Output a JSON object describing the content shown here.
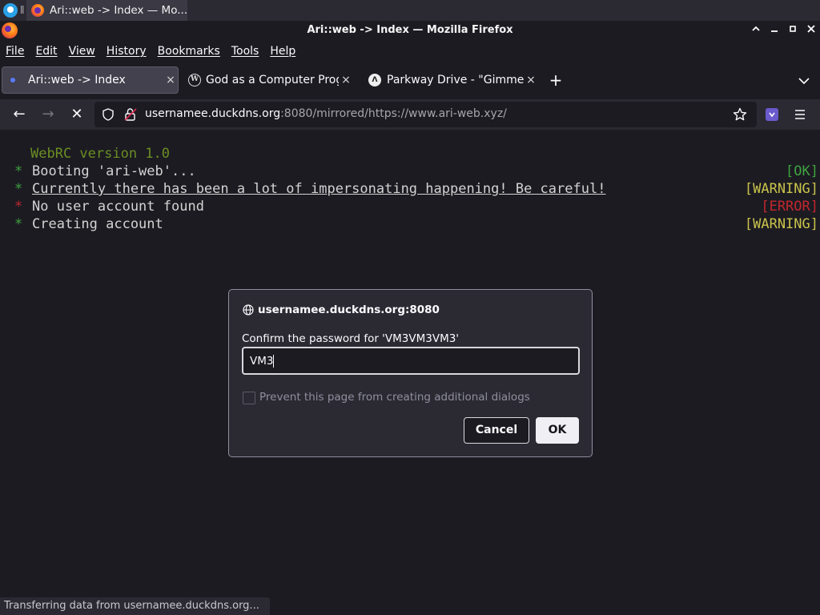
{
  "taskbar": {
    "separator": "ǁ",
    "task_title": "Ari::web -> Index — Mo..."
  },
  "window": {
    "title": "Ari::web -> Index — Mozilla Firefox",
    "controls": {
      "minimize": "–",
      "maximize": "□",
      "close": "✕"
    }
  },
  "menu": [
    "File",
    "Edit",
    "View",
    "History",
    "Bookmarks",
    "Tools",
    "Help"
  ],
  "tabs": [
    {
      "label": "Ari::web -> Index",
      "active": true,
      "close": "×"
    },
    {
      "label": "God as a Computer Progr",
      "favicon": "W",
      "close": "×"
    },
    {
      "label": "Parkway Drive - \"Gimme",
      "favicon": "Λ",
      "close": "×"
    }
  ],
  "newtab": "+",
  "nav": {
    "back": "←",
    "forward": "→",
    "stop": "✕",
    "url_host": "usernamee.duckdns.org",
    "url_rest": ":8080/mirrored/https://www.ari-web.xyz/"
  },
  "terminal": {
    "header": "WebRC version 1.0",
    "lines": [
      {
        "star": "*",
        "star_color": "#3fa33f",
        "text": "Booting 'ari-web'...",
        "status": "[OK]",
        "status_color": "#3fa33f",
        "underline": false
      },
      {
        "star": "*",
        "star_color": "#3fa33f",
        "text": "Currently there has been a lot of impersonating happening! Be careful!",
        "status": "[WARNING]",
        "status_color": "#c9c34a",
        "underline": true
      },
      {
        "star": "*",
        "star_color": "#c2272d",
        "text": "No user account found",
        "status": "[ERROR]",
        "status_color": "#c2272d",
        "underline": false
      },
      {
        "star": "*",
        "star_color": "#3fa33f",
        "text": "Creating account",
        "status": "[WARNING]",
        "status_color": "#c9c34a",
        "underline": false
      }
    ]
  },
  "dialog": {
    "origin": "usernamee.duckdns.org:8080",
    "message": "Confirm the password for 'VM3VM3VM3'",
    "input_value": "VM3",
    "checkbox_label": "Prevent this page from creating additional dialogs",
    "checkbox_checked": false,
    "cancel_label": "Cancel",
    "ok_label": "OK"
  },
  "statusbar": "Transferring data from usernamee.duckdns.org..."
}
